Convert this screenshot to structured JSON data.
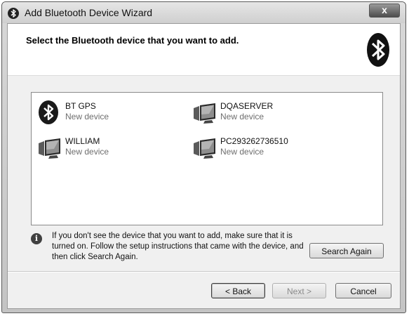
{
  "window": {
    "title": "Add Bluetooth Device Wizard",
    "close_symbol": "x"
  },
  "header": {
    "title": "Select the Bluetooth device that you want to add."
  },
  "devices": [
    {
      "name": "BT GPS",
      "status": "New device",
      "icon": "bluetooth-icon"
    },
    {
      "name": "DQASERVER",
      "status": "New device",
      "icon": "computer-icon"
    },
    {
      "name": "WILLIAM",
      "status": "New device",
      "icon": "computer-icon"
    },
    {
      "name": "PC293262736510",
      "status": "New device",
      "icon": "computer-icon"
    }
  ],
  "info": {
    "text": "If you don't see the device that you want to add, make sure that it is turned on. Follow the setup instructions that came with the device, and then click Search Again.",
    "symbol": "i"
  },
  "buttons": {
    "search_again": "Search Again",
    "back": "< Back",
    "next": "Next >",
    "cancel": "Cancel"
  }
}
